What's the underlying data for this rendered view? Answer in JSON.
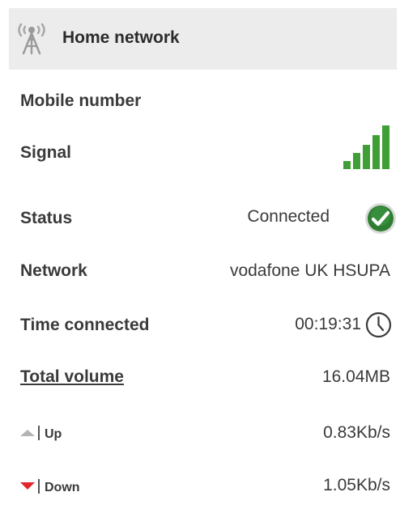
{
  "header": {
    "title": "Home network",
    "icon": "antenna-signal-icon"
  },
  "rows": {
    "mobile_number": {
      "label": "Mobile number",
      "value": ""
    },
    "signal": {
      "label": "Signal",
      "bars_active": 5,
      "bars_total": 5,
      "color": "#3f9e35"
    },
    "status": {
      "label": "Status",
      "value": "Connected",
      "icon": "check-circle-icon",
      "icon_color": "#2e7d32"
    },
    "network": {
      "label": "Network",
      "value": "vodafone UK HSUPA"
    },
    "time_connected": {
      "label": "Time connected",
      "value": "00:19:31",
      "icon": "clock-icon"
    },
    "total_volume": {
      "label": "Total volume",
      "value": "16.04MB"
    },
    "up": {
      "label": "Up",
      "value": "0.83Kb/s",
      "arrow_color": "#b4b4b4"
    },
    "down": {
      "label": "Down",
      "value": "1.05Kb/s",
      "arrow_color": "#e2262b"
    }
  }
}
